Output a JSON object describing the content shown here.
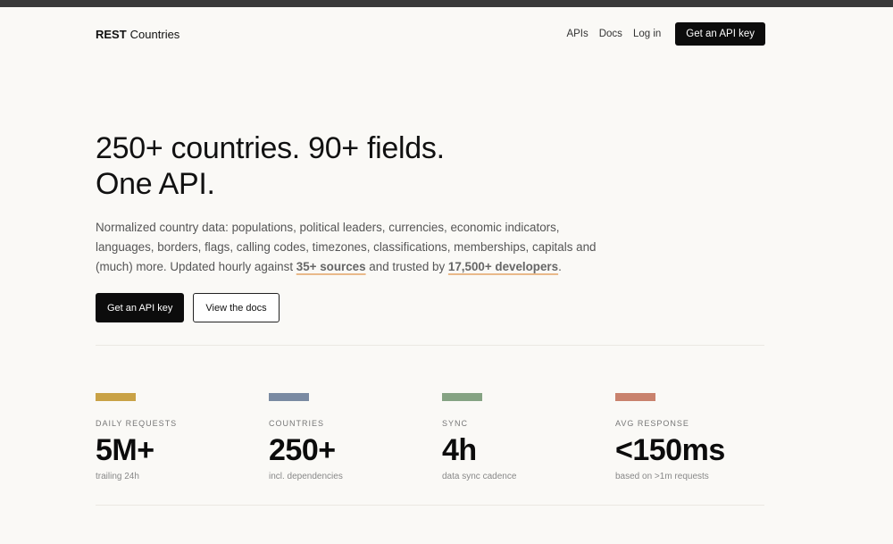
{
  "nav": {
    "brand_bold": "REST",
    "brand_light": "Countries",
    "links": [
      "APIs",
      "Docs",
      "Log in"
    ],
    "cta": "Get an API key"
  },
  "hero": {
    "line1": "250+ countries. 90+ fields.",
    "line2": "One API.",
    "desc_pre": "Normalized country data: populations, political leaders, currencies, economic indicators, languages, borders, flags, calling codes, timezones, classifications, memberships, capitals and (much) more. Updated hourly against ",
    "sources": "35+ sources",
    "desc_mid": " and trusted by ",
    "developers": "17,500+ developers",
    "desc_end": ".",
    "primary_button": "Get an API key",
    "secondary_button": "View the docs"
  },
  "stats": [
    {
      "label": "DAILY REQUESTS",
      "value": "5M+",
      "sub": "trailing 24h",
      "color": "#c9a246"
    },
    {
      "label": "COUNTRIES",
      "value": "250+",
      "sub": "incl. dependencies",
      "color": "#7a8aa2"
    },
    {
      "label": "SYNC",
      "value": "4h",
      "sub": "data sync cadence",
      "color": "#85a383"
    },
    {
      "label": "AVG RESPONSE",
      "value": "<150ms",
      "sub": "based on >1m requests",
      "color": "#c9826d"
    }
  ]
}
